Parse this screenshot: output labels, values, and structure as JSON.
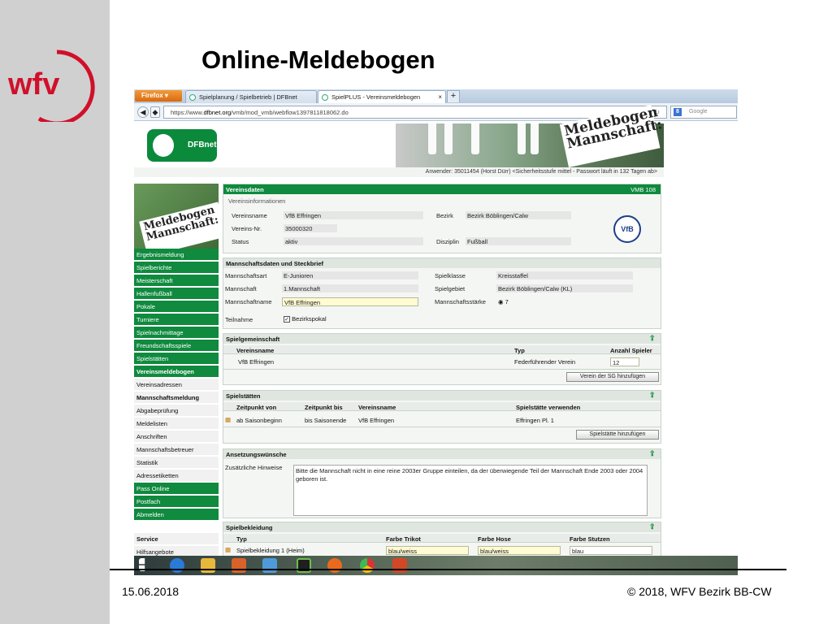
{
  "slide": {
    "title": "Online-Meldebogen",
    "date": "15.06.2018",
    "copyright": "© 2018, WFV Bezirk BB-CW",
    "logo_text": "wfv"
  },
  "browser": {
    "menu_button": "Firefox",
    "tabs": [
      {
        "label": "Spielplanung / Spielbetrieb | DFBnet"
      },
      {
        "label": "SpielPLUS - Vereinsmeldebogen"
      }
    ],
    "url_prefix": "https://www.",
    "url_domain": "dfbnet.org",
    "url_rest": "/vmb/mod_vmb/webflow1397811818062.do",
    "search_placeholder": "Google",
    "search_engine_letter": "8"
  },
  "header": {
    "dfb_logo": "DFBnet",
    "banner_text": "Meldebogen Mannschaft:",
    "user_line": "Anwender: 35011454 (Horst Dürr) <Sicherheitsstufe mittel - Passwort läuft in 132 Tagen ab>"
  },
  "sidebar": {
    "banner_text": "Meldebogen Mannschaft:",
    "items": [
      {
        "label": "Ergebnismeldung"
      },
      {
        "label": "Spielberichte"
      },
      {
        "label": "Meisterschaft"
      },
      {
        "label": "Hallenfußball"
      },
      {
        "label": "Pokale"
      },
      {
        "label": "Turniere"
      },
      {
        "label": "Spielnachmittage"
      },
      {
        "label": "Freundschaftsspiele"
      },
      {
        "label": "Spielstätten"
      },
      {
        "label": "Vereinsmeldebogen"
      },
      {
        "label": "Vereinsadressen"
      },
      {
        "label": "Mannschaftsmeldung"
      },
      {
        "label": "Abgabeprüfung"
      },
      {
        "label": "Meldelisten"
      },
      {
        "label": "Anschriften"
      },
      {
        "label": "Mannschaftsbetreuer"
      },
      {
        "label": "Statistik"
      },
      {
        "label": "Adressetiketten"
      },
      {
        "label": "Pass Online"
      },
      {
        "label": "Postfach"
      },
      {
        "label": "Abmelden"
      },
      {
        "label": "Service"
      },
      {
        "label": "Hilfsangebote"
      }
    ]
  },
  "vereinsdaten": {
    "title": "Vereinsdaten",
    "code": "VMB 108",
    "subtitle": "Vereinsinformationen",
    "vereinsname_label": "Vereinsname",
    "vereinsname": "VfB Effringen",
    "bezirk_label": "Bezirk",
    "bezirk": "Bezirk Böblingen/Calw",
    "nr_label": "Vereins-Nr.",
    "nr": "35000320",
    "status_label": "Status",
    "status": "aktiv",
    "disziplin_label": "Disziplin",
    "disziplin": "Fußball",
    "wappen": "VfB"
  },
  "mannschaft": {
    "title": "Mannschaftsdaten und Steckbrief",
    "art_label": "Mannschaftsart",
    "art": "E-Junioren",
    "klasse_label": "Spielklasse",
    "klasse": "Kreisstaffel",
    "mannschaft_label": "Mannschaft",
    "mannschaft": "1.Mannschaft",
    "gebiet_label": "Spielgebiet",
    "gebiet": "Bezirk Böblingen/Calw (KL)",
    "name_label": "Mannschaftname",
    "name": "VfB Effringen",
    "staerke_label": "Mannschaftsstärke",
    "staerke": "7",
    "teilnahme_label": "Teilnahme",
    "teilnahme": "Bezirkspokal"
  },
  "sg": {
    "title": "Spielgemeinschaft",
    "headers": [
      "Vereinsname",
      "Typ",
      "Anzahl Spieler"
    ],
    "row": {
      "name": "VfB Effringen",
      "typ": "Federführender Verein",
      "anzahl": "12"
    },
    "button": "Verein der SG hinzufügen"
  },
  "spielstaetten": {
    "title": "Spielstätten",
    "headers": [
      "Zeitpunkt von",
      "Zeitpunkt bis",
      "Vereinsname",
      "Spielstätte verwenden"
    ],
    "row": {
      "von": "ab Saisonbeginn",
      "bis": "bis Saisonende",
      "verein": "VfB Effringen",
      "staette": "Effringen Pl. 1"
    },
    "button": "Spielstätte hinzufügen"
  },
  "ansetzung": {
    "title": "Ansetzungswünsche",
    "label": "Zusätzliche Hinweise",
    "text": "Bitte die Mannschaft nicht in eine reine 2003er Gruppe einteilen, da der überwiegende Teil der Mannschaft Ende 2003 oder 2004 geboren ist."
  },
  "kleidung": {
    "title": "Spielbekleidung",
    "headers": [
      "Typ",
      "Farbe Trikot",
      "Farbe Hose",
      "Farbe Stutzen"
    ],
    "row": {
      "typ": "Spielbekleidung 1 (Heim)",
      "trikot": "blau/weiss",
      "hose": "blau/weiss",
      "stutzen": "blau"
    }
  }
}
